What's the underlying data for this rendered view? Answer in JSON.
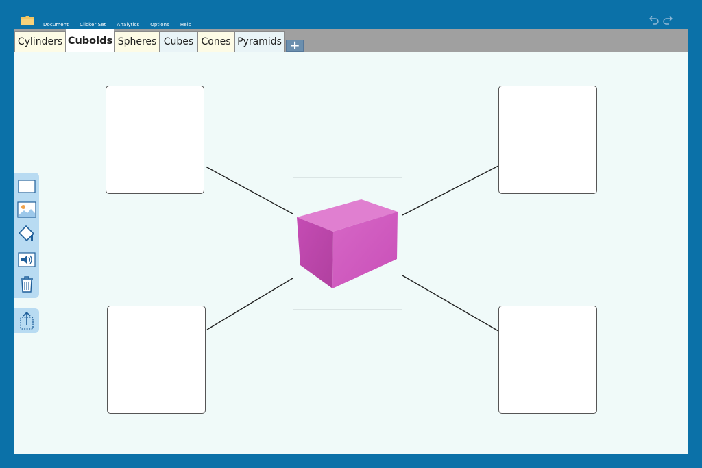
{
  "menu": {
    "items": [
      {
        "label": "Document"
      },
      {
        "label": "Clicker Set"
      },
      {
        "label": "Analytics"
      },
      {
        "label": "Options"
      },
      {
        "label": "Help"
      }
    ]
  },
  "tabs": [
    {
      "label": "Cylinders"
    },
    {
      "label": "Cuboids"
    },
    {
      "label": "Spheres"
    },
    {
      "label": "Cubes"
    },
    {
      "label": "Cones"
    },
    {
      "label": "Pyramids"
    }
  ],
  "active_tab": "Cuboids",
  "add_tab_label": "+",
  "canvas": {
    "center_image": "pink-cuboid-3d",
    "textboxes": [
      {
        "id": "top-left",
        "text": ""
      },
      {
        "id": "top-right",
        "text": ""
      },
      {
        "id": "bottom-left",
        "text": ""
      },
      {
        "id": "bottom-right",
        "text": ""
      }
    ]
  },
  "toolbar": {
    "tools": [
      "textbox-icon",
      "image-icon",
      "fill-icon",
      "audio-icon",
      "trash-icon"
    ],
    "share": "share-icon"
  },
  "colors": {
    "frame": "#0b71a8",
    "tab_strip": "#a0a0a0",
    "canvas": "#f0faf9",
    "cuboid": "#d863c6",
    "tool_panel": "#b8dbf2"
  }
}
